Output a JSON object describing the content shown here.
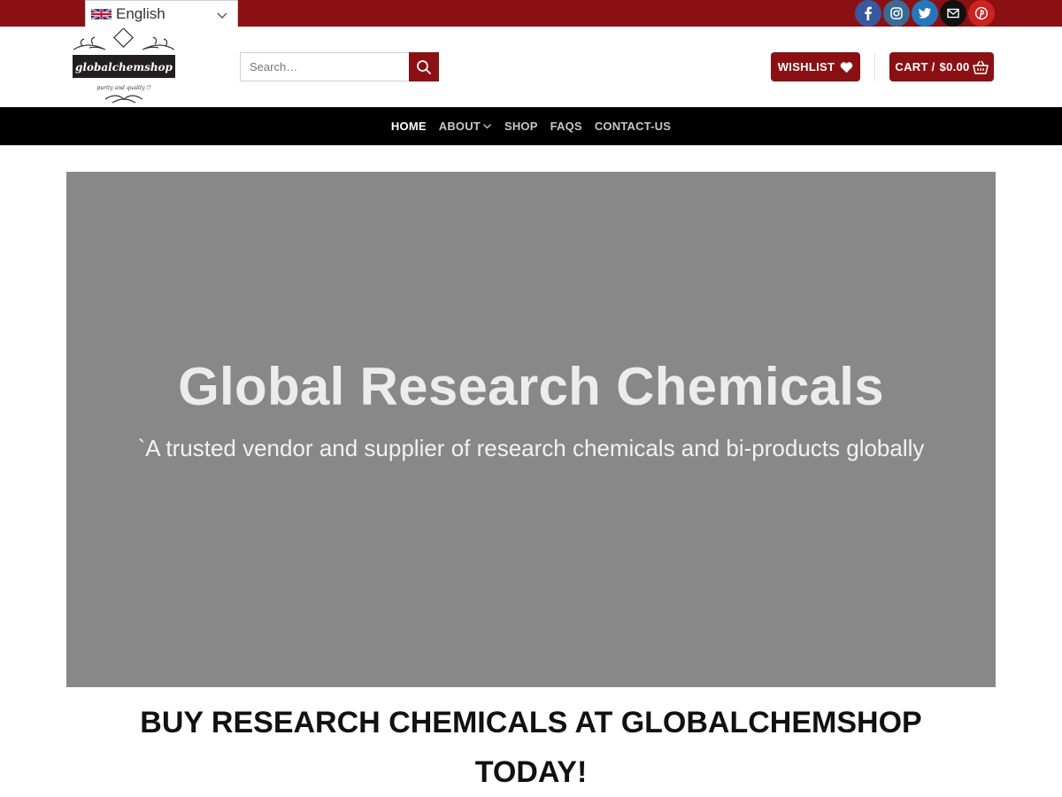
{
  "topbar": {
    "language": "English",
    "socials": [
      {
        "icon": "facebook-icon",
        "color": "#3a589d"
      },
      {
        "icon": "instagram-icon",
        "color": "#3b6994"
      },
      {
        "icon": "twitter-icon",
        "color": "#2478ba"
      },
      {
        "icon": "email-icon",
        "color": "#111111"
      },
      {
        "icon": "pinterest-icon",
        "color": "#cb2320"
      }
    ]
  },
  "header": {
    "logo_text": "globalchemshop",
    "logo_tagline": "purity and quality !!",
    "search_placeholder": "Search…",
    "wishlist_label": "WISHLIST",
    "cart_label": "CART /",
    "cart_amount": "$0.00"
  },
  "nav": {
    "items": [
      {
        "label": "HOME"
      },
      {
        "label": "ABOUT"
      },
      {
        "label": "SHOP"
      },
      {
        "label": "FAQS"
      },
      {
        "label": "CONTACT-US"
      }
    ]
  },
  "hero": {
    "title": "Global Research Chemicals",
    "subtitle": "`A trusted vendor and supplier of research chemicals and bi-products globally"
  },
  "section": {
    "title": "BUY RESEARCH CHEMICALS AT GLOBALCHEMSHOP TODAY!"
  },
  "colors": {
    "brand": "#8b1014",
    "nav_bg": "#000000",
    "hero_bg": "#888888"
  }
}
